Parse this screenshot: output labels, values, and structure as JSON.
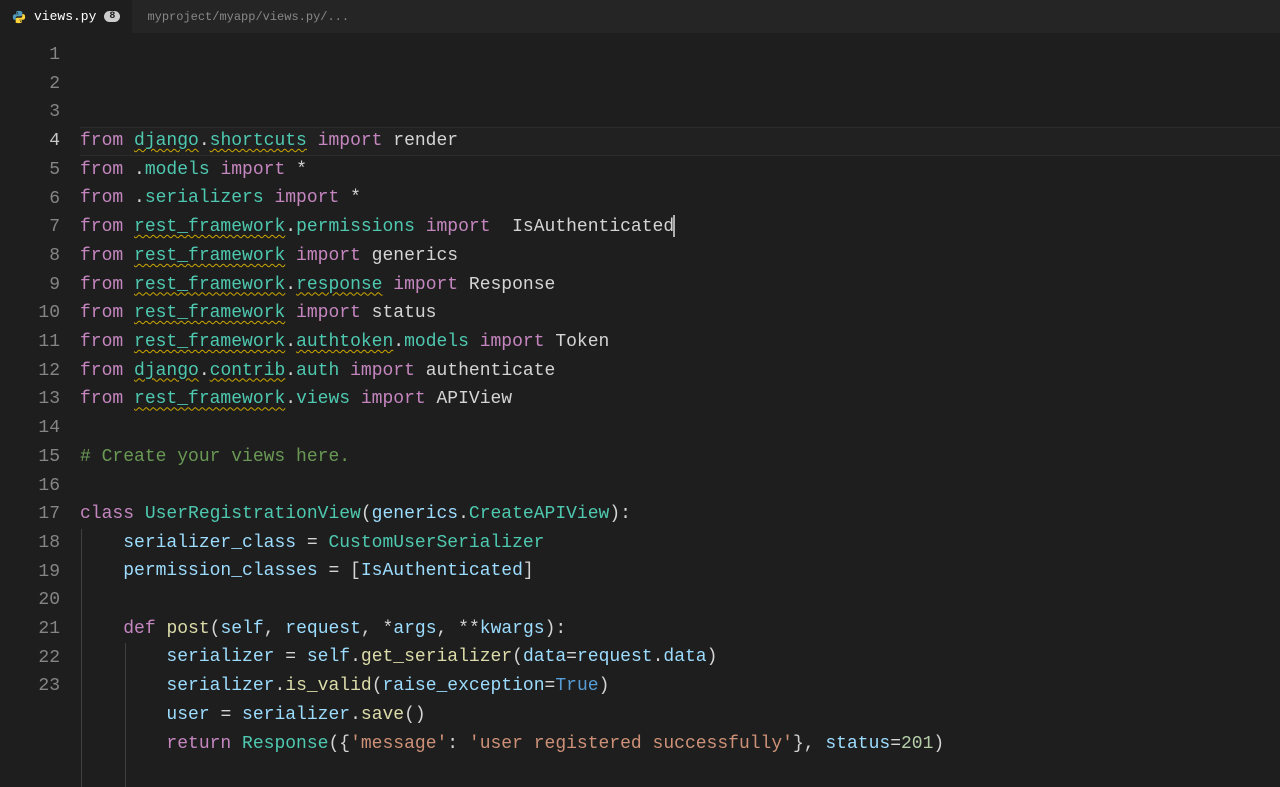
{
  "tab": {
    "filename": "views.py",
    "modified_count": "8"
  },
  "breadcrumb": "myproject/myapp/views.py/...",
  "current_line": 4,
  "lines": [
    {
      "num": 1,
      "tokens": [
        {
          "t": "from ",
          "c": "kw"
        },
        {
          "t": "django",
          "c": "mod"
        },
        {
          "t": ".",
          "c": "punct"
        },
        {
          "t": "shortcuts",
          "c": "mod"
        },
        {
          "t": " import ",
          "c": "kw"
        },
        {
          "t": "render",
          "c": "ident"
        }
      ]
    },
    {
      "num": 2,
      "tokens": [
        {
          "t": "from ",
          "c": "kw"
        },
        {
          "t": ".",
          "c": "punct"
        },
        {
          "t": "models",
          "c": "mod-plain"
        },
        {
          "t": " import ",
          "c": "kw"
        },
        {
          "t": "*",
          "c": "star"
        }
      ]
    },
    {
      "num": 3,
      "tokens": [
        {
          "t": "from ",
          "c": "kw"
        },
        {
          "t": ".",
          "c": "punct"
        },
        {
          "t": "serializers",
          "c": "mod-plain"
        },
        {
          "t": " import ",
          "c": "kw"
        },
        {
          "t": "*",
          "c": "star"
        }
      ]
    },
    {
      "num": 4,
      "tokens": [
        {
          "t": "from ",
          "c": "kw"
        },
        {
          "t": "rest_framework",
          "c": "mod"
        },
        {
          "t": ".",
          "c": "punct"
        },
        {
          "t": "permissions",
          "c": "mod-plain"
        },
        {
          "t": " import  ",
          "c": "kw"
        },
        {
          "t": "IsAuthenticated",
          "c": "ident"
        }
      ],
      "cursor": true
    },
    {
      "num": 5,
      "tokens": [
        {
          "t": "from ",
          "c": "kw"
        },
        {
          "t": "rest_framework",
          "c": "mod"
        },
        {
          "t": " import ",
          "c": "kw"
        },
        {
          "t": "generics",
          "c": "ident"
        }
      ]
    },
    {
      "num": 6,
      "tokens": [
        {
          "t": "from ",
          "c": "kw"
        },
        {
          "t": "rest_framework",
          "c": "mod"
        },
        {
          "t": ".",
          "c": "punct"
        },
        {
          "t": "response",
          "c": "mod"
        },
        {
          "t": " import ",
          "c": "kw"
        },
        {
          "t": "Response",
          "c": "ident"
        }
      ]
    },
    {
      "num": 7,
      "tokens": [
        {
          "t": "from ",
          "c": "kw"
        },
        {
          "t": "rest_framework",
          "c": "mod"
        },
        {
          "t": " import ",
          "c": "kw"
        },
        {
          "t": "status",
          "c": "ident"
        }
      ]
    },
    {
      "num": 8,
      "tokens": [
        {
          "t": "from ",
          "c": "kw"
        },
        {
          "t": "rest_framework",
          "c": "mod"
        },
        {
          "t": ".",
          "c": "punct"
        },
        {
          "t": "authtoken",
          "c": "mod"
        },
        {
          "t": ".",
          "c": "punct"
        },
        {
          "t": "models",
          "c": "mod-plain"
        },
        {
          "t": " import ",
          "c": "kw"
        },
        {
          "t": "Token",
          "c": "ident"
        }
      ]
    },
    {
      "num": 9,
      "tokens": [
        {
          "t": "from ",
          "c": "kw"
        },
        {
          "t": "django",
          "c": "mod"
        },
        {
          "t": ".",
          "c": "punct"
        },
        {
          "t": "contrib",
          "c": "mod"
        },
        {
          "t": ".",
          "c": "punct"
        },
        {
          "t": "auth",
          "c": "mod-plain"
        },
        {
          "t": " import ",
          "c": "kw"
        },
        {
          "t": "authenticate",
          "c": "ident"
        }
      ]
    },
    {
      "num": 10,
      "tokens": [
        {
          "t": "from ",
          "c": "kw"
        },
        {
          "t": "rest_framework",
          "c": "mod"
        },
        {
          "t": ".",
          "c": "punct"
        },
        {
          "t": "views",
          "c": "mod-plain"
        },
        {
          "t": " import ",
          "c": "kw"
        },
        {
          "t": "APIView",
          "c": "ident"
        }
      ]
    },
    {
      "num": 11,
      "tokens": []
    },
    {
      "num": 12,
      "tokens": [
        {
          "t": "# Create your views here.",
          "c": "comment"
        }
      ]
    },
    {
      "num": 13,
      "tokens": []
    },
    {
      "num": 14,
      "tokens": [
        {
          "t": "class ",
          "c": "kw"
        },
        {
          "t": "UserRegistrationView",
          "c": "cls"
        },
        {
          "t": "(",
          "c": "punct"
        },
        {
          "t": "generics",
          "c": "var"
        },
        {
          "t": ".",
          "c": "punct"
        },
        {
          "t": "CreateAPIView",
          "c": "cls"
        },
        {
          "t": "):",
          "c": "punct"
        }
      ]
    },
    {
      "num": 15,
      "indent": 1,
      "tokens": [
        {
          "t": "    ",
          "c": ""
        },
        {
          "t": "serializer_class",
          "c": "var"
        },
        {
          "t": " = ",
          "c": "op"
        },
        {
          "t": "CustomUserSerializer",
          "c": "cls"
        }
      ]
    },
    {
      "num": 16,
      "indent": 1,
      "tokens": [
        {
          "t": "    ",
          "c": ""
        },
        {
          "t": "permission_classes",
          "c": "var"
        },
        {
          "t": " = [",
          "c": "op"
        },
        {
          "t": "IsAuthenticated",
          "c": "var"
        },
        {
          "t": "]",
          "c": "op"
        }
      ]
    },
    {
      "num": 17,
      "indent": 1,
      "tokens": []
    },
    {
      "num": 18,
      "indent": 1,
      "tokens": [
        {
          "t": "    ",
          "c": ""
        },
        {
          "t": "def ",
          "c": "kw"
        },
        {
          "t": "post",
          "c": "fn"
        },
        {
          "t": "(",
          "c": "punct"
        },
        {
          "t": "self",
          "c": "param"
        },
        {
          "t": ", ",
          "c": "punct"
        },
        {
          "t": "request",
          "c": "param"
        },
        {
          "t": ", *",
          "c": "punct"
        },
        {
          "t": "args",
          "c": "param"
        },
        {
          "t": ", **",
          "c": "punct"
        },
        {
          "t": "kwargs",
          "c": "param"
        },
        {
          "t": "):",
          "c": "punct"
        }
      ]
    },
    {
      "num": 19,
      "indent": 2,
      "tokens": [
        {
          "t": "        ",
          "c": ""
        },
        {
          "t": "serializer",
          "c": "var"
        },
        {
          "t": " = ",
          "c": "op"
        },
        {
          "t": "self",
          "c": "var"
        },
        {
          "t": ".",
          "c": "punct"
        },
        {
          "t": "get_serializer",
          "c": "fn"
        },
        {
          "t": "(",
          "c": "punct"
        },
        {
          "t": "data",
          "c": "param"
        },
        {
          "t": "=",
          "c": "op"
        },
        {
          "t": "request",
          "c": "var"
        },
        {
          "t": ".",
          "c": "punct"
        },
        {
          "t": "data",
          "c": "var"
        },
        {
          "t": ")",
          "c": "punct"
        }
      ]
    },
    {
      "num": 20,
      "indent": 2,
      "tokens": [
        {
          "t": "        ",
          "c": ""
        },
        {
          "t": "serializer",
          "c": "var"
        },
        {
          "t": ".",
          "c": "punct"
        },
        {
          "t": "is_valid",
          "c": "fn"
        },
        {
          "t": "(",
          "c": "punct"
        },
        {
          "t": "raise_exception",
          "c": "param"
        },
        {
          "t": "=",
          "c": "op"
        },
        {
          "t": "True",
          "c": "const"
        },
        {
          "t": ")",
          "c": "punct"
        }
      ]
    },
    {
      "num": 21,
      "indent": 2,
      "tokens": [
        {
          "t": "        ",
          "c": ""
        },
        {
          "t": "user",
          "c": "var"
        },
        {
          "t": " = ",
          "c": "op"
        },
        {
          "t": "serializer",
          "c": "var"
        },
        {
          "t": ".",
          "c": "punct"
        },
        {
          "t": "save",
          "c": "fn"
        },
        {
          "t": "()",
          "c": "punct"
        }
      ]
    },
    {
      "num": 22,
      "indent": 2,
      "tokens": [
        {
          "t": "        ",
          "c": ""
        },
        {
          "t": "return ",
          "c": "kw"
        },
        {
          "t": "Response",
          "c": "cls"
        },
        {
          "t": "({",
          "c": "punct"
        },
        {
          "t": "'message'",
          "c": "str"
        },
        {
          "t": ": ",
          "c": "punct"
        },
        {
          "t": "'user registered successfully'",
          "c": "str"
        },
        {
          "t": "}, ",
          "c": "punct"
        },
        {
          "t": "status",
          "c": "param"
        },
        {
          "t": "=",
          "c": "op"
        },
        {
          "t": "201",
          "c": "num"
        },
        {
          "t": ")",
          "c": "punct"
        }
      ]
    },
    {
      "num": 23,
      "indent": 2,
      "tokens": []
    }
  ]
}
